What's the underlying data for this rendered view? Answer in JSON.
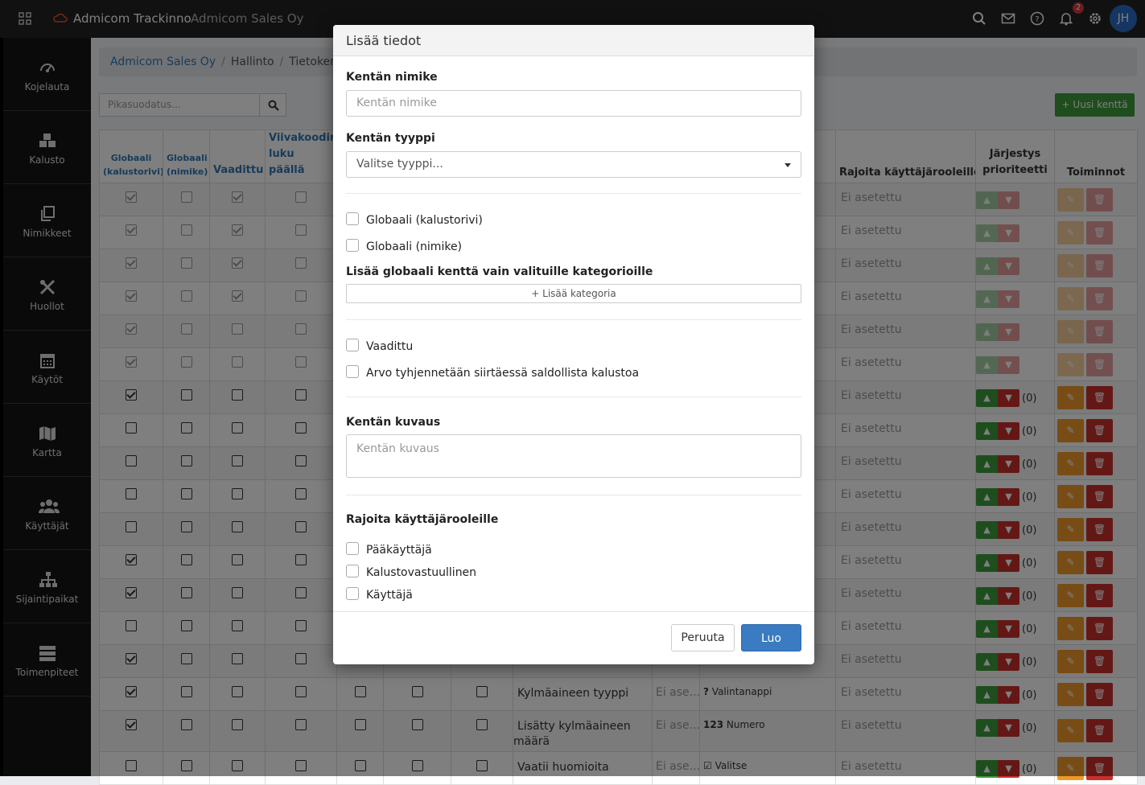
{
  "topbar": {
    "app_name": "Admicom Trackinno",
    "company": "Admicom Sales Oy",
    "notification_count": "2",
    "avatar_initials": "JH"
  },
  "sidebar": {
    "items": [
      {
        "label": "Kojelauta",
        "icon": "dashboard-icon"
      },
      {
        "label": "Kalusto",
        "icon": "boxes-icon"
      },
      {
        "label": "Nimikkeet",
        "icon": "copy-icon"
      },
      {
        "label": "Huollot",
        "icon": "tools-icon"
      },
      {
        "label": "Käytöt",
        "icon": "calendar-icon"
      },
      {
        "label": "Kartta",
        "icon": "map-icon"
      },
      {
        "label": "Käyttäjät",
        "icon": "users-icon"
      },
      {
        "label": "Sijaintipaikat",
        "icon": "sitemap-icon"
      },
      {
        "label": "Toimenpiteet",
        "icon": "server-icon"
      }
    ]
  },
  "breadcrumb": [
    "Admicom Sales Oy",
    "Hallinto",
    "Tietoken"
  ],
  "filter": {
    "placeholder": "Pikasuodatus..."
  },
  "new_field_button": "Uusi kenttä",
  "table": {
    "headers": {
      "global_row": "Globaali (kalustorivi)",
      "global_item": "Globaali (nimike)",
      "required": "Vaadittu",
      "barcode": "Viivakoodin luku päällä",
      "restrict_roles": "Rajoita käyttäjärooleille",
      "order": "Järjestys prioriteetti",
      "actions": "Toiminnot"
    },
    "not_set": "Ei asetettu",
    "truncated": "Ei ase...",
    "count": "(0)",
    "rows": [
      {
        "g1": true,
        "g2": false,
        "req": true,
        "dim": true
      },
      {
        "g1": true,
        "g2": false,
        "req": true,
        "dim": true
      },
      {
        "g1": true,
        "g2": false,
        "req": true,
        "dim": true
      },
      {
        "g1": true,
        "g2": false,
        "req": true,
        "dim": true
      },
      {
        "g1": true,
        "g2": false,
        "req": false,
        "dim": true
      },
      {
        "g1": true,
        "g2": false,
        "req": false,
        "dim": true
      },
      {
        "g1": true,
        "g2": false,
        "req": false,
        "dim": false
      },
      {
        "g1": false,
        "g2": false,
        "req": false,
        "dim": false
      },
      {
        "g1": false,
        "g2": false,
        "req": false,
        "dim": false
      },
      {
        "g1": false,
        "g2": false,
        "req": false,
        "dim": false
      },
      {
        "g1": false,
        "g2": false,
        "req": false,
        "dim": false
      },
      {
        "g1": true,
        "g2": false,
        "req": false,
        "dim": false
      },
      {
        "g1": true,
        "g2": false,
        "req": false,
        "dim": false
      },
      {
        "g1": false,
        "g2": false,
        "req": false,
        "dim": false
      },
      {
        "g1": true,
        "g2": false,
        "req": false,
        "dim": false
      },
      {
        "g1": true,
        "g2": false,
        "req": false,
        "dim": false,
        "name": "Kylmäaineen tyyppi",
        "type": "Valintanappi",
        "type_icon": "?"
      },
      {
        "g1": true,
        "g2": false,
        "req": false,
        "dim": false,
        "name": "Lisätty kylmäaineen määrä",
        "type": "Numero",
        "type_icon": "123"
      },
      {
        "g1": false,
        "g2": false,
        "req": false,
        "dim": false,
        "name": "Vaatii huomioita",
        "type": "Valitse",
        "type_icon": "☑"
      }
    ]
  },
  "modal": {
    "title": "Lisää tiedot",
    "name_label": "Kentän nimike",
    "name_placeholder": "Kentän nimike",
    "type_label": "Kentän tyyppi",
    "type_placeholder": "Valitse tyyppi...",
    "global_row": "Globaali (kalustorivi)",
    "global_item": "Globaali (nimike)",
    "category_label": "Lisää globaali kenttä vain valituille kategorioille",
    "add_category": "Lisää kategoria",
    "required": "Vaadittu",
    "clear_on_move": "Arvo tyhjennetään siirtäessä saldollista kalustoa",
    "desc_label": "Kentän kuvaus",
    "desc_placeholder": "Kentän kuvaus",
    "roles_label": "Rajoita käyttäjärooleille",
    "roles": [
      "Pääkäyttäjä",
      "Kalustovastuullinen",
      "Käyttäjä"
    ],
    "cancel": "Peruuta",
    "create": "Luo"
  }
}
